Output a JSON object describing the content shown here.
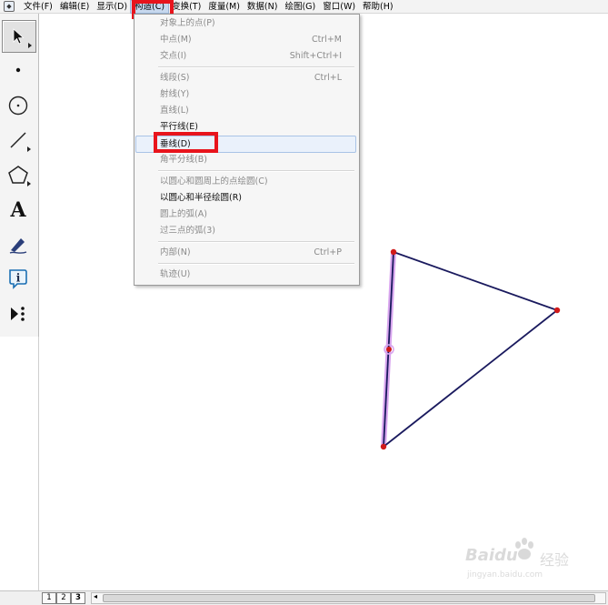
{
  "menubar": {
    "items": [
      {
        "label": "文件(F)"
      },
      {
        "label": "编辑(E)"
      },
      {
        "label": "显示(D)"
      },
      {
        "label": "构造(C)"
      },
      {
        "label": "变换(T)"
      },
      {
        "label": "度量(M)"
      },
      {
        "label": "数据(N)"
      },
      {
        "label": "绘图(G)"
      },
      {
        "label": "窗口(W)"
      },
      {
        "label": "帮助(H)"
      }
    ],
    "active_index": 3
  },
  "toolbar": {
    "text_tool_glyph": "A",
    "tools": [
      "arrow-select-icon",
      "point-icon",
      "compass-icon",
      "straightedge-icon",
      "polygon-icon",
      "text-icon",
      "marker-icon",
      "information-icon",
      "custom-tool-icon"
    ]
  },
  "construct_menu": {
    "items": [
      {
        "label": "对象上的点(P)",
        "shortcut": "",
        "enabled": false
      },
      {
        "label": "中点(M)",
        "shortcut": "Ctrl+M",
        "enabled": false
      },
      {
        "label": "交点(I)",
        "shortcut": "Shift+Ctrl+I",
        "enabled": false
      },
      {
        "label": "线段(S)",
        "shortcut": "Ctrl+L",
        "enabled": false
      },
      {
        "label": "射线(Y)",
        "shortcut": "",
        "enabled": false
      },
      {
        "label": "直线(L)",
        "shortcut": "",
        "enabled": false
      },
      {
        "label": "平行线(E)",
        "shortcut": "",
        "enabled": true
      },
      {
        "label": "垂线(D)",
        "shortcut": "",
        "enabled": true,
        "highlighted": true
      },
      {
        "label": "角平分线(B)",
        "shortcut": "",
        "enabled": false
      },
      {
        "label": "以圆心和圆周上的点绘圆(C)",
        "shortcut": "",
        "enabled": false
      },
      {
        "label": "以圆心和半径绘圆(R)",
        "shortcut": "",
        "enabled": true
      },
      {
        "label": "圆上的弧(A)",
        "shortcut": "",
        "enabled": false
      },
      {
        "label": "过三点的弧(3)",
        "shortcut": "",
        "enabled": false
      },
      {
        "label": "内部(N)",
        "shortcut": "Ctrl+P",
        "enabled": false
      },
      {
        "label": "轨迹(U)",
        "shortcut": "",
        "enabled": false
      }
    ]
  },
  "sketch": {
    "segment_color": "#1a1a5e",
    "selected_halo_color": "#d9a6ef",
    "point_color": "#d01a1a"
  },
  "page_tabs": [
    "1",
    "2",
    "3"
  ],
  "scroll_arrow_glyph": "◂",
  "watermark": {
    "brand": "Baidu",
    "suffix": "经验",
    "url": "jingyan.baidu.com"
  },
  "colors": {
    "highlight_box": "#e8141c"
  }
}
